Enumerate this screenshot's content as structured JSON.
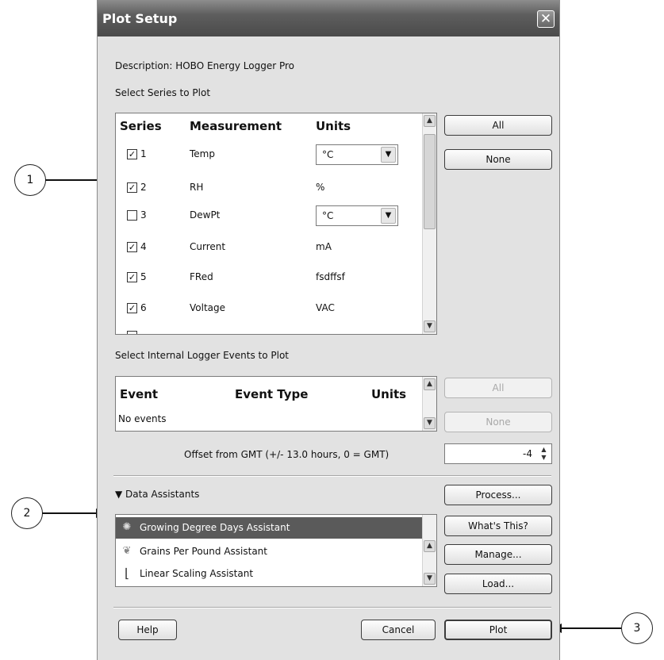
{
  "window": {
    "title": "Plot Setup",
    "close_glyph": "✕"
  },
  "description": "Description: HOBO Energy Logger Pro",
  "series_section": {
    "label": "Select Series to Plot",
    "headers": {
      "series": "Series",
      "measurement": "Measurement",
      "units": "Units"
    },
    "rows": [
      {
        "checked": true,
        "number": "1",
        "measurement": "Temp",
        "units": "°C",
        "units_dropdown": true
      },
      {
        "checked": true,
        "number": "2",
        "measurement": "RH",
        "units": "%",
        "units_dropdown": false
      },
      {
        "checked": false,
        "number": "3",
        "measurement": "DewPt",
        "units": "°C",
        "units_dropdown": true
      },
      {
        "checked": true,
        "number": "4",
        "measurement": "Current",
        "units": "mA",
        "units_dropdown": false
      },
      {
        "checked": true,
        "number": "5",
        "measurement": "FRed",
        "units": "fsdffsf",
        "units_dropdown": false
      },
      {
        "checked": true,
        "number": "6",
        "measurement": "Voltage",
        "units": "VAC",
        "units_dropdown": false
      }
    ],
    "all_button": "All",
    "none_button": "None"
  },
  "events_section": {
    "label": "Select Internal Logger Events to Plot",
    "headers": {
      "event": "Event",
      "event_type": "Event Type",
      "units": "Units"
    },
    "empty_text": "No events",
    "all_button": "All",
    "none_button": "None"
  },
  "gmt_offset": {
    "label": "Offset from GMT (+/- 13.0 hours, 0 = GMT)",
    "value": "-4"
  },
  "data_assistants": {
    "label": "▼ Data Assistants",
    "items": [
      {
        "label": "Growing Degree Days Assistant",
        "icon": "sun-gear-icon",
        "glyph": "✺",
        "selected": true
      },
      {
        "label": "Grains Per Pound Assistant",
        "icon": "leaf-icon",
        "glyph": "❦",
        "selected": false
      },
      {
        "label": "Linear Scaling Assistant",
        "icon": "chart-axis-icon",
        "glyph": "⌊",
        "selected": false
      }
    ],
    "buttons": {
      "process": "Process...",
      "whats_this": "What's This?",
      "manage": "Manage...",
      "load": "Load..."
    }
  },
  "footer": {
    "help": "Help",
    "cancel": "Cancel",
    "plot": "Plot"
  },
  "callouts": [
    "1",
    "2",
    "3"
  ],
  "colors": {
    "selection": "#5a5a5a",
    "titlebar": "#5e5e5e",
    "dialog_bg": "#e2e2e2"
  }
}
